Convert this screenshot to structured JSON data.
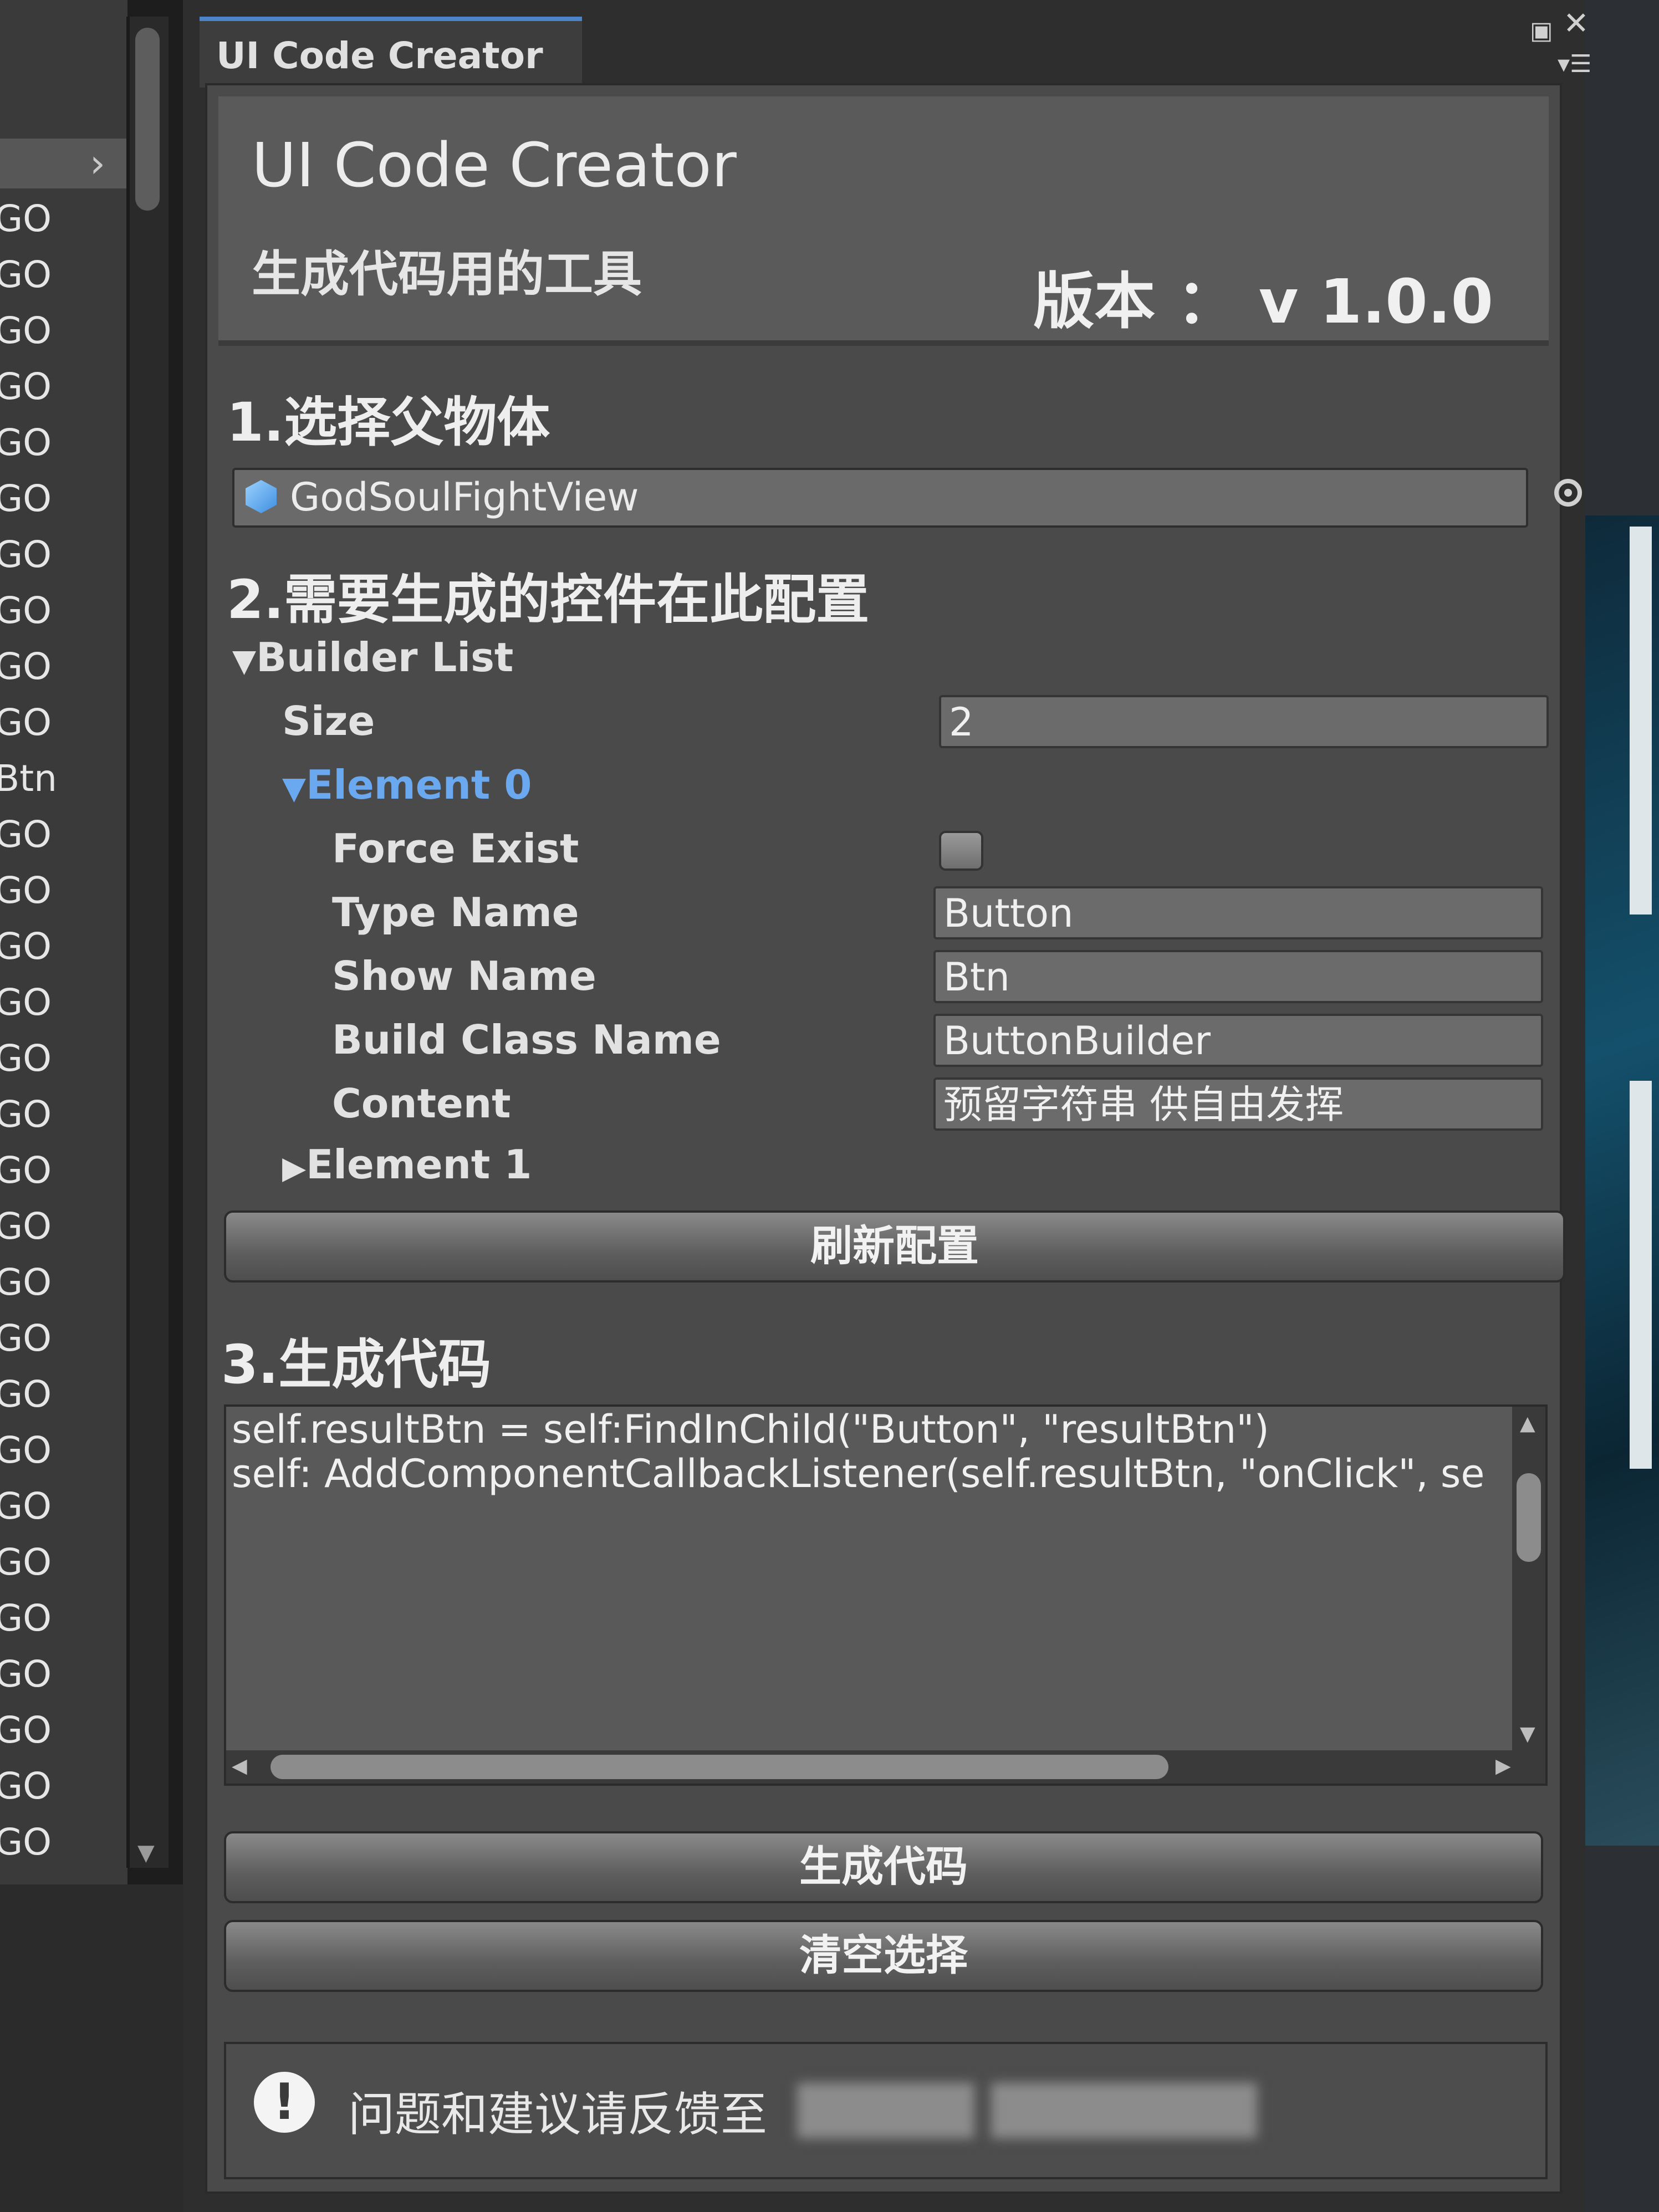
{
  "left_panel": {
    "items": [
      "GO",
      "GO",
      "GO",
      "GO",
      "GO",
      "GO",
      "GO",
      "GO",
      "GO",
      "GO",
      "Btn",
      "GO",
      "GO",
      "GO",
      "GO",
      "GO",
      "GO",
      "GO",
      "GO",
      "GO",
      "GO",
      "GO",
      "GO",
      "GO",
      "GO",
      "GO",
      "GO",
      "GO",
      "GO",
      "GO"
    ]
  },
  "window": {
    "tab_title": "UI Code Creator",
    "maximize_icon": "maximize-icon",
    "close_icon": "close-icon",
    "menu_icon": "tab-menu-icon"
  },
  "header": {
    "title": "UI Code Creator",
    "subtitle": "生成代码用的工具",
    "version": "版本 ： v 1.0.0"
  },
  "section1": {
    "title": "1.选择父物体",
    "object_value": "GodSoulFightView",
    "object_icon": "gameobject-icon",
    "picker_icon": "object-picker-icon"
  },
  "section2": {
    "title": "2.需要生成的控件在此配置",
    "builder_list_label": "Builder List",
    "size_label": "Size",
    "size_value": "2",
    "element0_label": "Element 0",
    "element0": {
      "force_exist_label": "Force Exist",
      "force_exist_checked": false,
      "type_name_label": "Type Name",
      "type_name_value": "Button",
      "show_name_label": "Show Name",
      "show_name_value": "Btn",
      "build_class_label": "Build Class Name",
      "build_class_value": "ButtonBuilder",
      "content_label": "Content",
      "content_value": "预留字符串 供自由发挥"
    },
    "element1_label": "Element 1",
    "refresh_button": "刷新配置"
  },
  "section3": {
    "title": "3.生成代码",
    "code_lines": [
      "self.resultBtn = self:FindInChild(\"Button\", \"resultBtn\")",
      "self: AddComponentCallbackListener(self.resultBtn, \"onClick\", se"
    ],
    "generate_button": "生成代码",
    "clear_button": "清空选择"
  },
  "footer": {
    "text": "问题和建议请反馈至",
    "icon": "info-icon"
  },
  "colors": {
    "window_bg": "#4a4a4a",
    "header_bg": "#5a5a5a",
    "field_bg": "#6b6b6b",
    "accent_blue": "#6aa8f0",
    "tab_accent": "#4b84c9"
  }
}
